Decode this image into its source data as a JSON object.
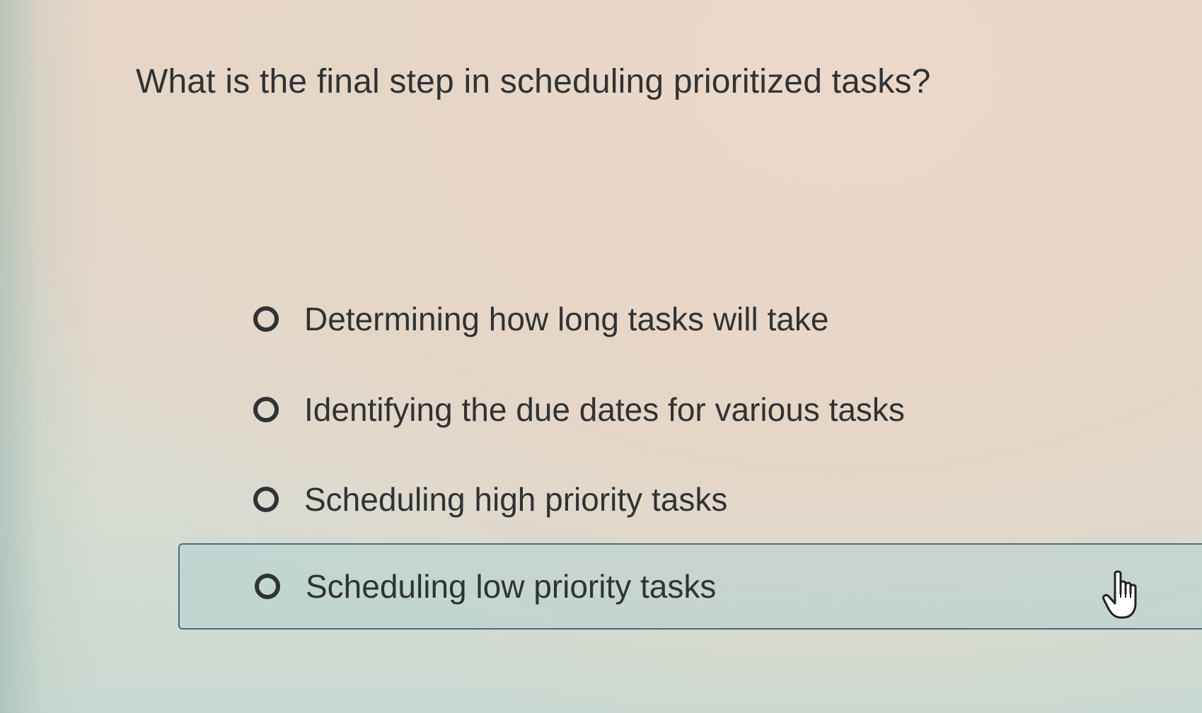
{
  "question": {
    "text": "What is the final step in scheduling prioritized tasks?"
  },
  "options": [
    {
      "label": "Determining how long tasks will take",
      "selected": false
    },
    {
      "label": "Identifying the due dates for various tasks",
      "selected": false
    },
    {
      "label": "Scheduling high priority tasks",
      "selected": false
    },
    {
      "label": "Scheduling low priority tasks",
      "selected": false,
      "hovered": true
    }
  ],
  "cursor": {
    "icon": "pointer-hand-icon"
  },
  "colors": {
    "text": "#2f3336",
    "hover_border": "#3f6f86",
    "hover_fill": "#a0cdd2"
  }
}
